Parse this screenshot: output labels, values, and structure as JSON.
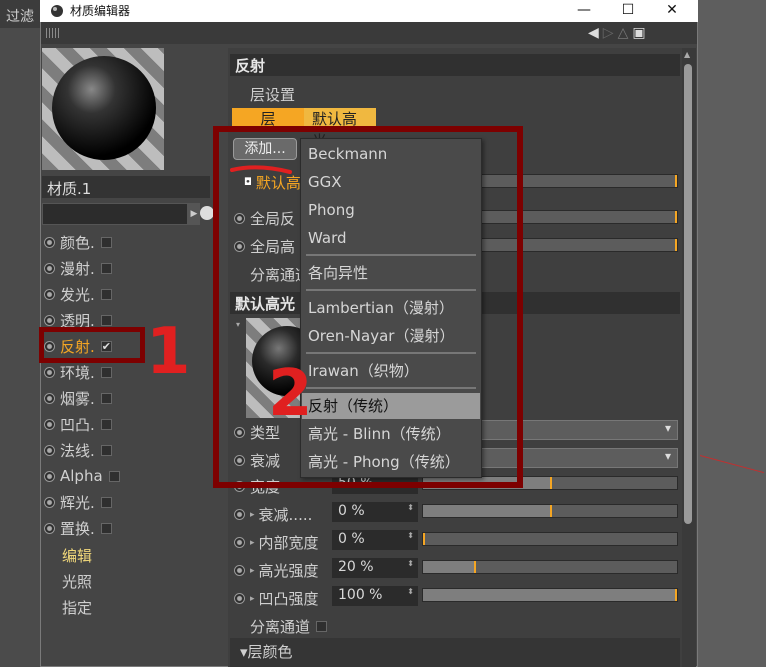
{
  "background": {
    "partial_text": "过滤"
  },
  "window": {
    "title": "材质编辑器",
    "minimize": "—",
    "maximize": "☐",
    "close": "✕"
  },
  "toolbar": {
    "icons": [
      "arrow-left-icon",
      "arrow-right-icon",
      "triangle-icon",
      "pin-icon"
    ]
  },
  "material": {
    "name": "材质.1"
  },
  "channels": [
    {
      "label": "颜色.",
      "checked": false
    },
    {
      "label": "漫射.",
      "checked": false
    },
    {
      "label": "发光.",
      "checked": false
    },
    {
      "label": "透明.",
      "checked": false
    },
    {
      "label": "反射.",
      "checked": true,
      "active": true
    },
    {
      "label": "环境.",
      "checked": false
    },
    {
      "label": "烟雾.",
      "checked": false
    },
    {
      "label": "凹凸.",
      "checked": false
    },
    {
      "label": "法线.",
      "checked": false
    },
    {
      "label": "Alpha",
      "checked": false
    },
    {
      "label": "辉光.",
      "checked": false
    },
    {
      "label": "置换.",
      "checked": false
    }
  ],
  "nav": {
    "edit": "编辑",
    "lighting": "光照",
    "assign": "指定"
  },
  "reflect": {
    "header": "反射",
    "layer_settings": "层设置",
    "tabs": [
      "层",
      "默认高光"
    ],
    "add_button": "添加...",
    "rows": [
      "默认高...",
      "全局反",
      "全局高",
      "分离通道"
    ]
  },
  "specular": {
    "header": "默认高光",
    "type_label": "类型",
    "atten_label": "衰减",
    "width_label": "宽度",
    "width_value": "50 %",
    "falloff_label": "衰减.....",
    "falloff_value": "0 %",
    "inner_label": "内部宽度",
    "inner_value": "0 %",
    "strength_label": "高光强度",
    "strength_value": "20 %",
    "bump_label": "凹凸强度",
    "bump_value": "100 %",
    "sep_channel": "分离通道",
    "layer_color": "▾层颜色",
    "levels": {
      "width": 0.5,
      "falloff": 0.5,
      "inner": 0.0,
      "strength": 0.2,
      "bump": 1.0
    }
  },
  "menu": {
    "items": [
      "Beckmann",
      "GGX",
      "Phong",
      "Ward",
      "各向异性",
      "Lambertian（漫射）",
      "Oren-Nayar（漫射）",
      "Irawan（织物）",
      "反射（传统）",
      "高光 - Blinn（传统）",
      "高光 - Phong（传统）"
    ],
    "selected": "反射（传统）"
  },
  "annotations": {
    "mark1": "1",
    "mark2": "2"
  },
  "colors": {
    "accent": "#f5a623",
    "highlight_box": "#7d0000",
    "annotation": "#e02020"
  }
}
